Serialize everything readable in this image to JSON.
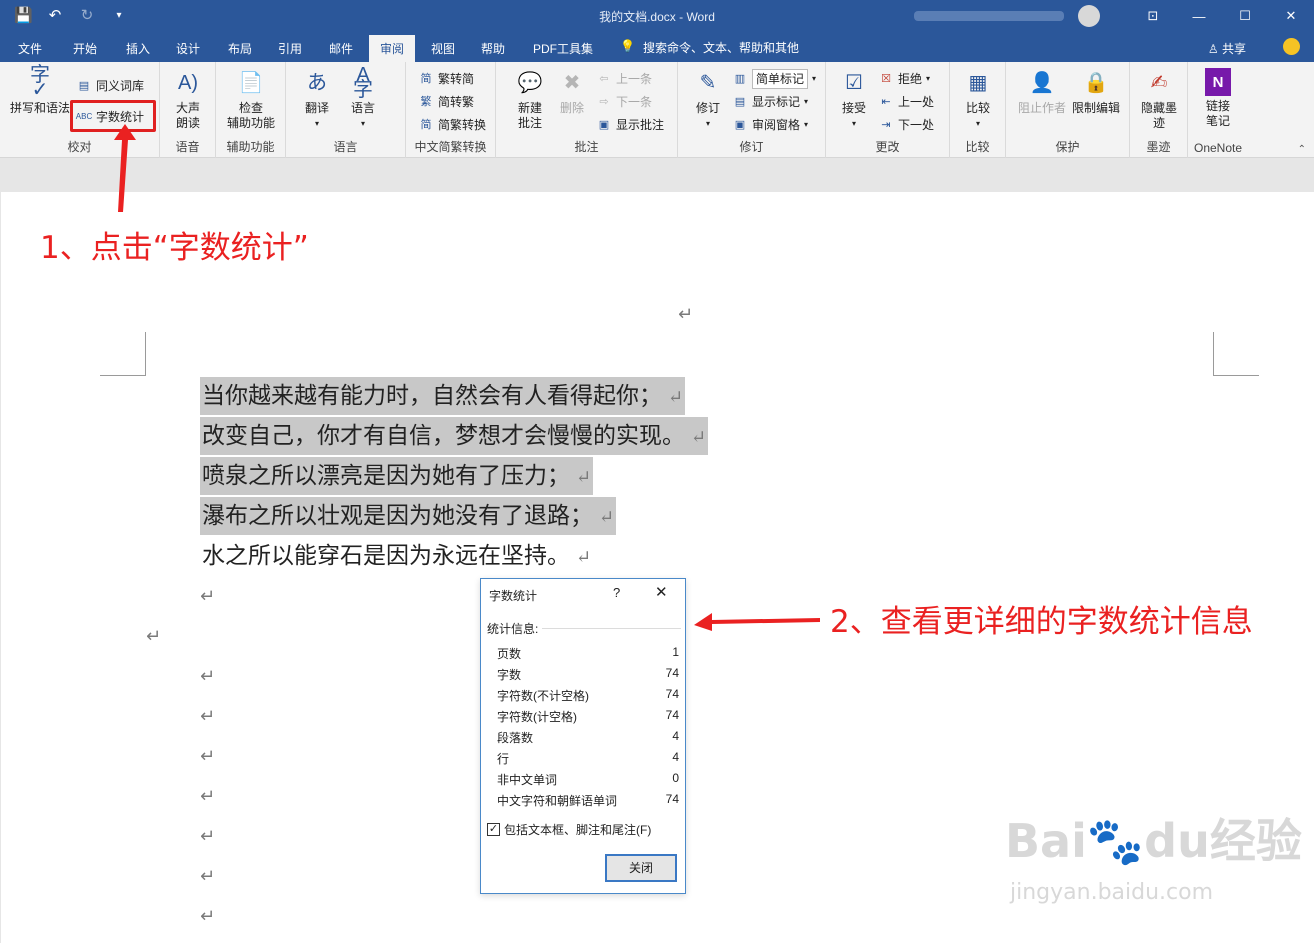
{
  "window": {
    "title": "我的文档.docx  -  Word",
    "qat_icons": [
      "save-icon",
      "undo-icon",
      "redo-icon",
      "customize-icon"
    ],
    "controls": [
      "ribbon-options-icon",
      "minimize-icon",
      "maximize-icon",
      "close-icon"
    ]
  },
  "tabs": [
    "文件",
    "开始",
    "插入",
    "设计",
    "布局",
    "引用",
    "邮件",
    "审阅",
    "视图",
    "帮助",
    "PDF工具集"
  ],
  "active_tab": "审阅",
  "search_hint": "搜索命令、文本、帮助和其他",
  "share_label": "共享",
  "ribbon": {
    "proofing": {
      "label": "校对",
      "spelling": "拼写和语法",
      "thesaurus": "同义词库",
      "word_count": "字数统计"
    },
    "speech": {
      "label": "语音",
      "read_aloud_1": "大声",
      "read_aloud_2": "朗读"
    },
    "accessibility": {
      "label": "辅助功能",
      "check_1": "检查",
      "check_2": "辅助功能"
    },
    "language": {
      "label": "语言",
      "translate": "翻译",
      "language": "语言"
    },
    "chinese_conversion": {
      "label": "中文简繁转换",
      "to_simplified": "繁转简",
      "to_traditional": "简转繁",
      "convert": "简繁转换"
    },
    "comments": {
      "label": "批注",
      "new_1": "新建",
      "new_2": "批注",
      "delete": "删除",
      "prev": "上一条",
      "next": "下一条",
      "show": "显示批注"
    },
    "tracking": {
      "label": "修订",
      "track": "修订",
      "markup": "简单标记",
      "show_markup": "显示标记",
      "pane": "审阅窗格"
    },
    "changes": {
      "label": "更改",
      "accept": "接受",
      "reject": "拒绝",
      "prev": "上一处",
      "next": "下一处"
    },
    "compare": {
      "label": "比较",
      "compare": "比较"
    },
    "protect": {
      "label": "保护",
      "block": "阻止作者",
      "restrict": "限制编辑"
    },
    "ink": {
      "label": "墨迹",
      "hide_1": "隐藏墨",
      "hide_2": "迹"
    },
    "onenote": {
      "label": "OneNote",
      "link_1": "链接",
      "link_2": "笔记"
    }
  },
  "document": {
    "lines": [
      "当你越来越有能力时，自然会有人看得起你；",
      "改变自己，你才有自信，梦想才会慢慢的实现。",
      "喷泉之所以漂亮是因为她有了压力；",
      "瀑布之所以壮观是因为她没有了退路；",
      "水之所以能穿石是因为永远在坚持。"
    ],
    "paragraph_mark": "↵"
  },
  "annotations": {
    "step1": "1、点击“字数统计”",
    "step2": "2、查看更详细的字数统计信息"
  },
  "dialog": {
    "title": "字数统计",
    "help": "?",
    "close": "✕",
    "section": "统计信息:",
    "stats": [
      {
        "label": "页数",
        "value": "1"
      },
      {
        "label": "字数",
        "value": "74"
      },
      {
        "label": "字符数(不计空格)",
        "value": "74"
      },
      {
        "label": "字符数(计空格)",
        "value": "74"
      },
      {
        "label": "段落数",
        "value": "4"
      },
      {
        "label": "行",
        "value": "4"
      },
      {
        "label": "非中文单词",
        "value": "0"
      },
      {
        "label": "中文字符和朝鲜语单词",
        "value": "74"
      }
    ],
    "checkbox_label": "包括文本框、脚注和尾注(F)",
    "checkbox_checked": true,
    "button": "关闭"
  },
  "watermark": {
    "brand": "Bai🐾du经验",
    "url": "jingyan.baidu.com"
  },
  "colors": {
    "accent": "#2b579a",
    "annotation": "#ea2121",
    "selection": "#c8c8c8"
  }
}
